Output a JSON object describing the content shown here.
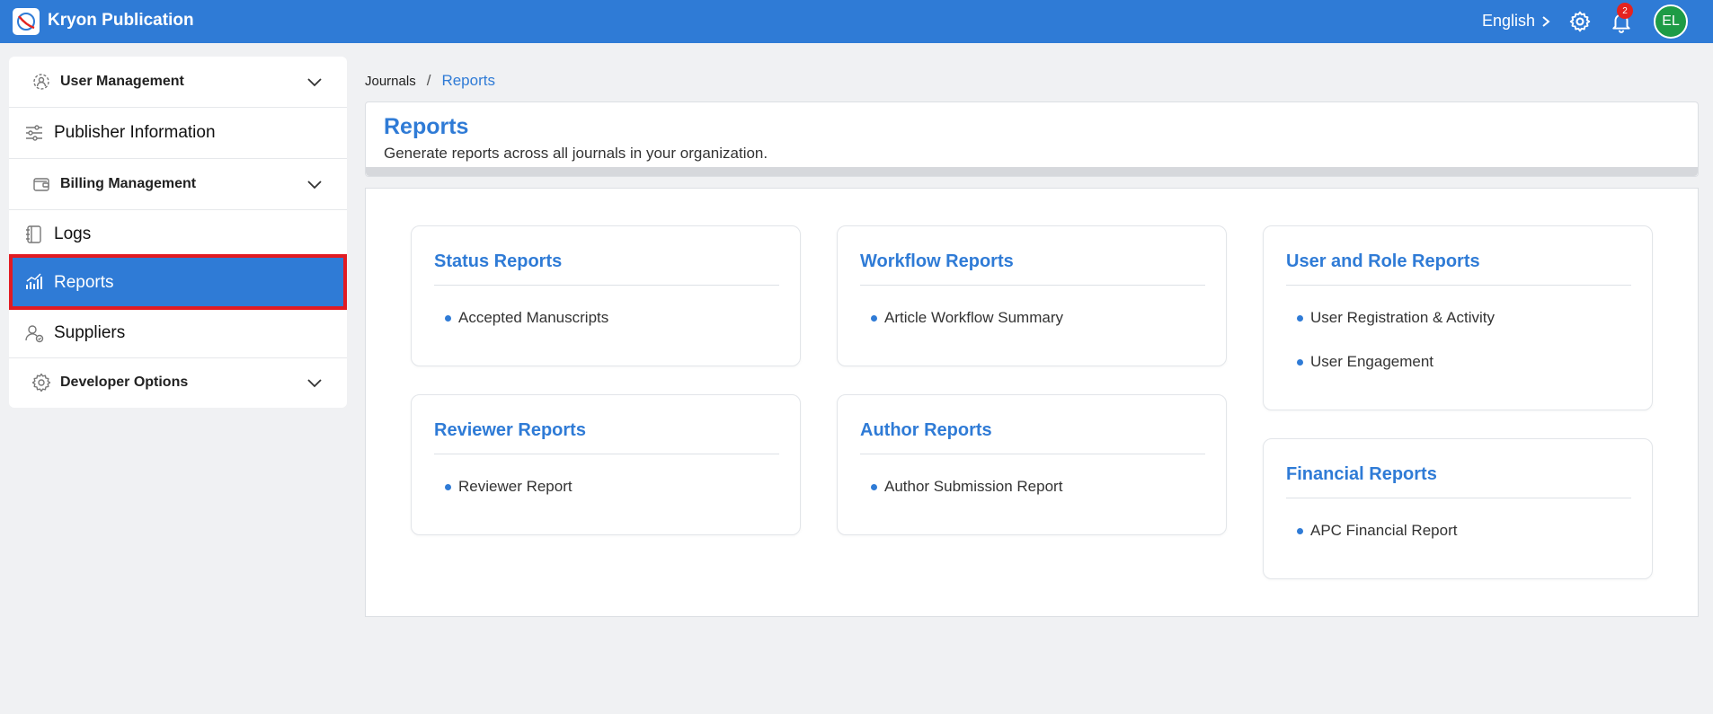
{
  "app": {
    "title": "Kryon Publication"
  },
  "topbar": {
    "language": "English",
    "notification_count": "2",
    "avatar_initials": "EL"
  },
  "sidebar": {
    "items": [
      {
        "label": "User Management",
        "icon": "users-gear-icon",
        "expandable": true
      },
      {
        "label": "Publisher Information",
        "icon": "sliders-icon",
        "expandable": false
      },
      {
        "label": "Billing Management",
        "icon": "wallet-icon",
        "expandable": true
      },
      {
        "label": "Logs",
        "icon": "notebook-icon",
        "expandable": false
      },
      {
        "label": "Reports",
        "icon": "bar-chart-icon",
        "expandable": false,
        "active": true
      },
      {
        "label": "Suppliers",
        "icon": "user-check-icon",
        "expandable": false
      },
      {
        "label": "Developer Options",
        "icon": "gear-icon",
        "expandable": true
      }
    ]
  },
  "breadcrumb": {
    "parent": "Journals",
    "separator": "/",
    "current": "Reports"
  },
  "header": {
    "title": "Reports",
    "subtitle": "Generate reports across all journals in your organization."
  },
  "cards": [
    {
      "title": "Status Reports",
      "items": [
        "Accepted Manuscripts"
      ]
    },
    {
      "title": "Workflow Reports",
      "items": [
        "Article Workflow Summary"
      ]
    },
    {
      "title": "User and Role Reports",
      "items": [
        "User Registration & Activity",
        "User Engagement"
      ]
    },
    {
      "title": "Reviewer Reports",
      "items": [
        "Reviewer Report"
      ]
    },
    {
      "title": "Author Reports",
      "items": [
        "Author Submission Report"
      ]
    },
    {
      "title": "Financial Reports",
      "items": [
        "APC Financial Report"
      ]
    }
  ],
  "colors": {
    "primary": "#2f7bd6",
    "highlight_border": "#e11b22",
    "badge": "#e5231f",
    "avatar": "#1e9b46"
  }
}
